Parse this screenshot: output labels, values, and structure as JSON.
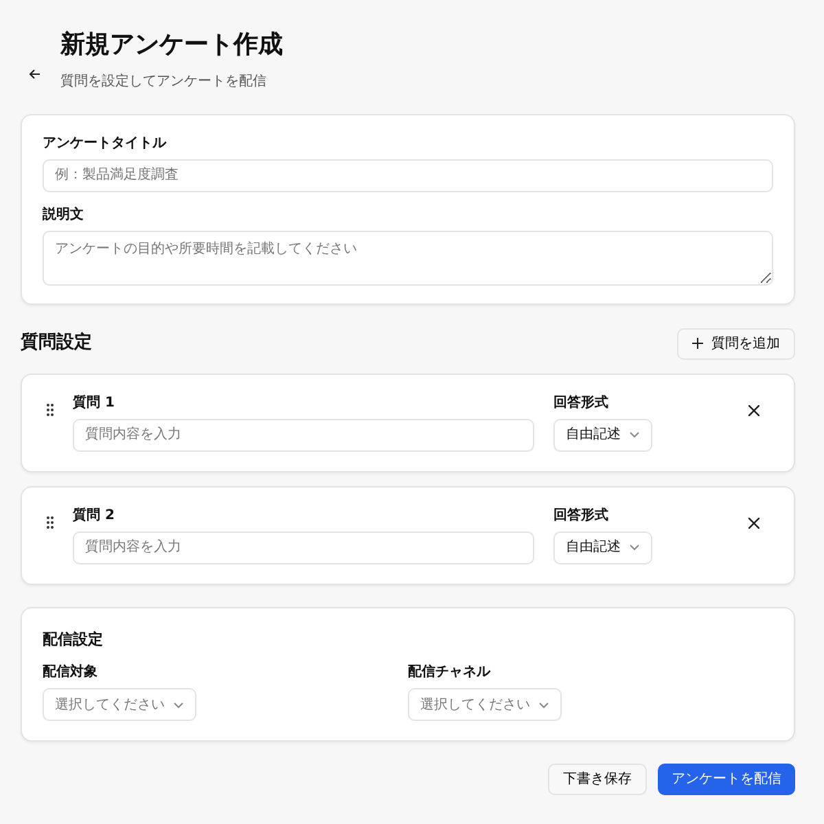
{
  "header": {
    "title": "新規アンケート作成",
    "subtitle": "質問を設定してアンケートを配信"
  },
  "basic": {
    "title_label": "アンケートタイトル",
    "title_placeholder": "例：製品満足度調査",
    "desc_label": "説明文",
    "desc_placeholder": "アンケートの目的や所要時間を記載してください"
  },
  "questions_section": {
    "heading": "質問設定",
    "add_button": "質問を追加"
  },
  "questions": [
    {
      "label": "質問 1",
      "placeholder": "質問内容を入力",
      "format_label": "回答形式",
      "format_value": "自由記述"
    },
    {
      "label": "質問 2",
      "placeholder": "質問内容を入力",
      "format_label": "回答形式",
      "format_value": "自由記述"
    }
  ],
  "delivery": {
    "heading": "配信設定",
    "fields": [
      {
        "label": "配信対象",
        "placeholder": "選択してください"
      },
      {
        "label": "配信チャネル",
        "placeholder": "選択してください"
      }
    ]
  },
  "actions": {
    "draft": "下書き保存",
    "publish": "アンケートを配信"
  }
}
